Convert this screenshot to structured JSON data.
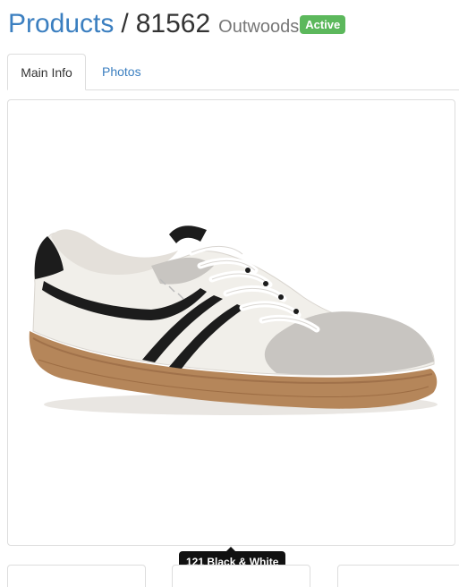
{
  "header": {
    "breadcrumb_link": "Products",
    "separator": "/",
    "product_id": "81562",
    "brand": "Outwoods",
    "status_badge": "Active",
    "status_color": "#5cb85c",
    "link_color": "#3b7fc0"
  },
  "tabs": [
    {
      "label": "Main Info",
      "active": true
    },
    {
      "label": "Photos",
      "active": false
    }
  ],
  "image": {
    "icon": "sneaker-image"
  },
  "tooltip": {
    "text": "121 Black & White"
  }
}
